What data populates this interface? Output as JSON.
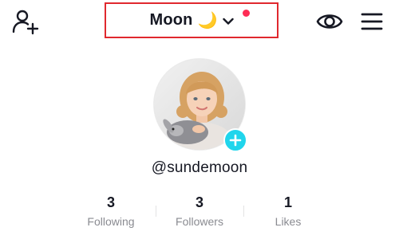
{
  "header": {
    "account_name": "Moon",
    "account_emoji": "🌙",
    "icons": {
      "add_friend": "add-user-icon",
      "dropdown": "chevron-down-icon",
      "eye": "eye-icon",
      "menu": "hamburger-menu-icon"
    },
    "notification_dot_color": "#fe2c55",
    "highlight_color": "#e0282e"
  },
  "profile": {
    "handle": "@sundemoon",
    "avatar_badge_icon": "plus-icon",
    "badge_color": "#20d5ec"
  },
  "stats": [
    {
      "value": "3",
      "label": "Following"
    },
    {
      "value": "3",
      "label": "Followers"
    },
    {
      "value": "1",
      "label": "Likes"
    }
  ]
}
